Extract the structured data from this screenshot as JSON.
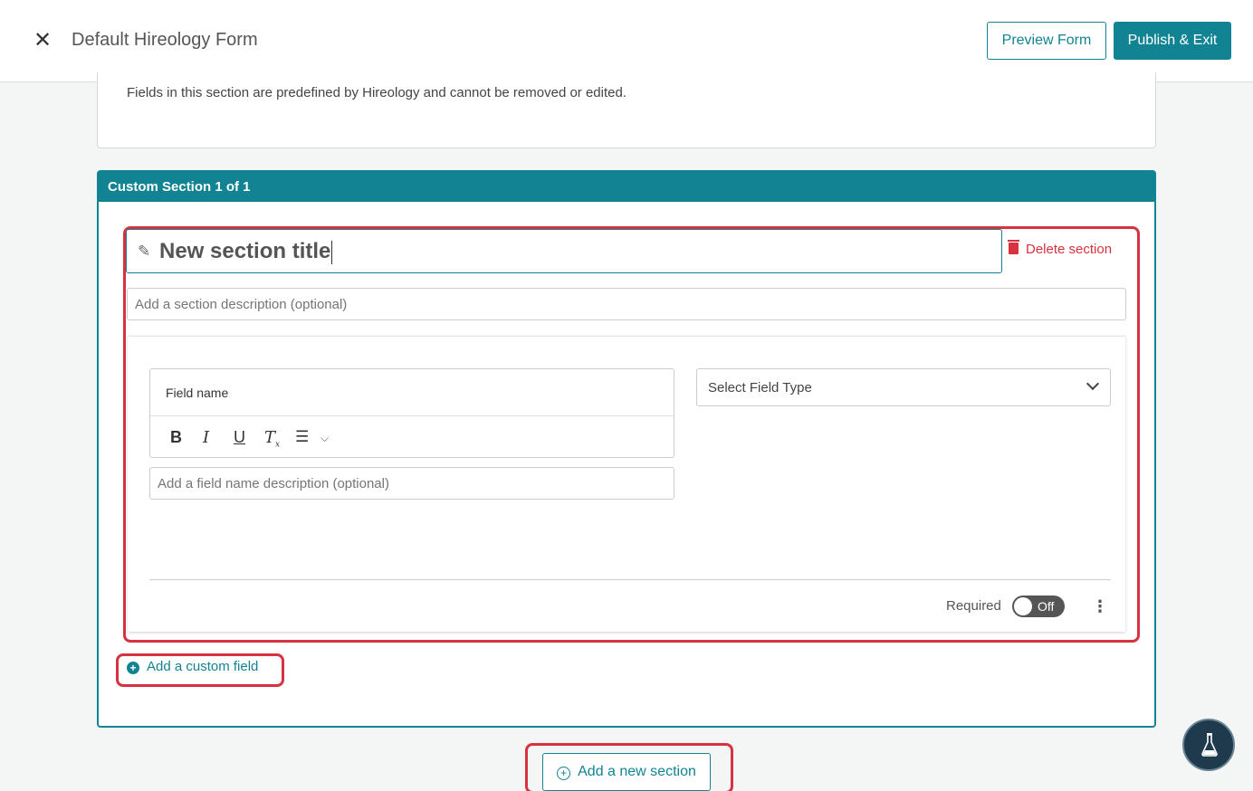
{
  "header": {
    "close_icon": "close-icon",
    "title": "Default Hireology Form",
    "preview_label": "Preview Form",
    "publish_label": "Publish & Exit"
  },
  "predefined": {
    "note": "Fields in this section are predefined by Hireology and cannot be removed or edited."
  },
  "custom_section": {
    "header": "Custom Section 1 of 1",
    "title_value": "New section title",
    "delete_label": "Delete section",
    "description_placeholder": "Add a section description (optional)",
    "field": {
      "name_value": "Field name",
      "description_placeholder": "Add a field name description (optional)",
      "type_placeholder": "Select Field Type",
      "required_label": "Required",
      "required_state": "Off",
      "toolbar_icons": [
        "bold-icon",
        "italic-icon",
        "underline-icon",
        "clear-format-icon",
        "bullet-list-icon",
        "chevron-down-icon"
      ]
    },
    "add_field_label": "Add a custom field"
  },
  "add_section_label": "Add a new section",
  "colors": {
    "accent": "#128393",
    "danger": "#d6323f",
    "help_bg": "#1e3a4c"
  }
}
